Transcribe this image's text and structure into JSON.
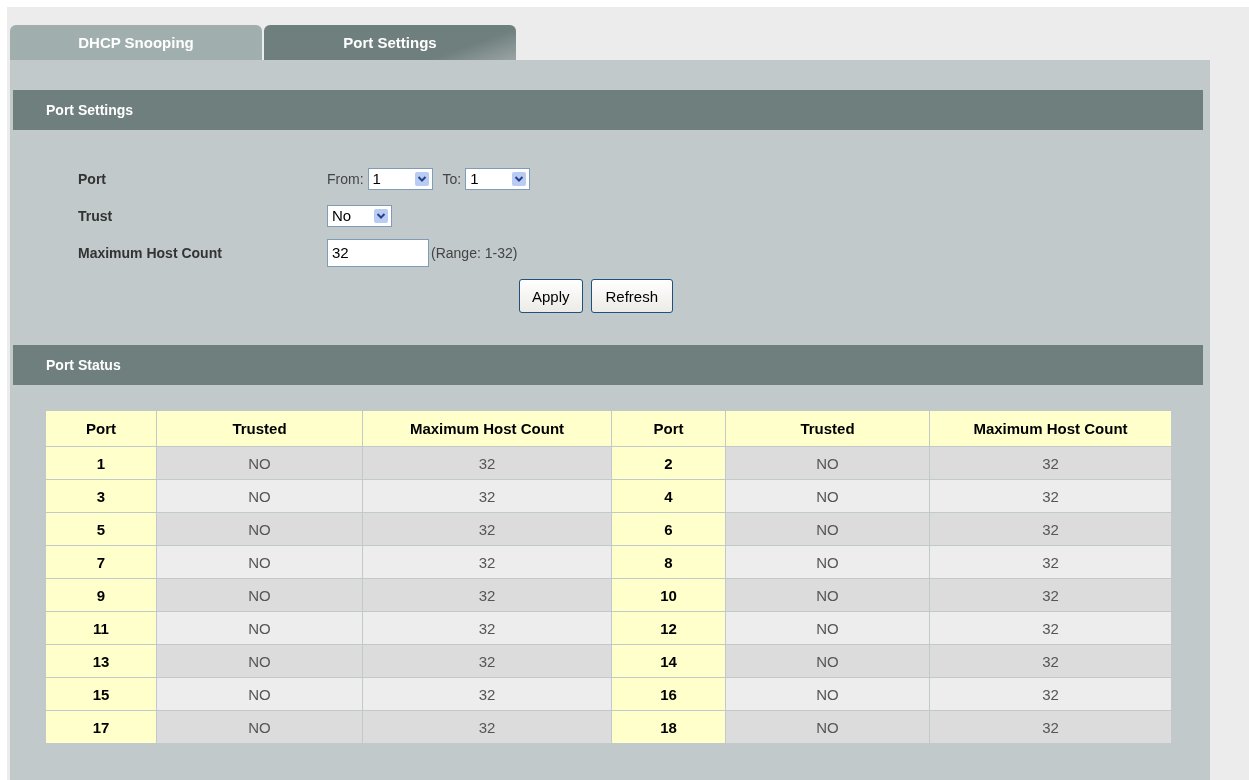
{
  "tabs": [
    {
      "label": "DHCP Snooping",
      "selected": false
    },
    {
      "label": "Port Settings",
      "selected": true
    }
  ],
  "settings": {
    "title": "Port Settings",
    "port": {
      "label": "Port",
      "from_label": "From:",
      "from_value": "1",
      "to_label": "To:",
      "to_value": "1"
    },
    "trust": {
      "label": "Trust",
      "value": "No"
    },
    "max_host": {
      "label": "Maximum Host Count",
      "value": "32",
      "hint": "(Range: 1-32)"
    },
    "buttons": [
      "Apply",
      "Refresh"
    ]
  },
  "status": {
    "title": "Port Status",
    "table": {
      "columns": [
        "Port",
        "Trusted",
        "Maximum Host Count",
        "Port",
        "Trusted",
        "Maximum Host Count"
      ],
      "rows": [
        [
          "1",
          "NO",
          "32",
          "2",
          "NO",
          "32"
        ],
        [
          "3",
          "NO",
          "32",
          "4",
          "NO",
          "32"
        ],
        [
          "5",
          "NO",
          "32",
          "6",
          "NO",
          "32"
        ],
        [
          "7",
          "NO",
          "32",
          "8",
          "NO",
          "32"
        ],
        [
          "9",
          "NO",
          "32",
          "10",
          "NO",
          "32"
        ],
        [
          "11",
          "NO",
          "32",
          "12",
          "NO",
          "32"
        ],
        [
          "13",
          "NO",
          "32",
          "14",
          "NO",
          "32"
        ],
        [
          "15",
          "NO",
          "32",
          "16",
          "NO",
          "32"
        ],
        [
          "17",
          "NO",
          "32",
          "18",
          "NO",
          "32"
        ]
      ]
    }
  }
}
